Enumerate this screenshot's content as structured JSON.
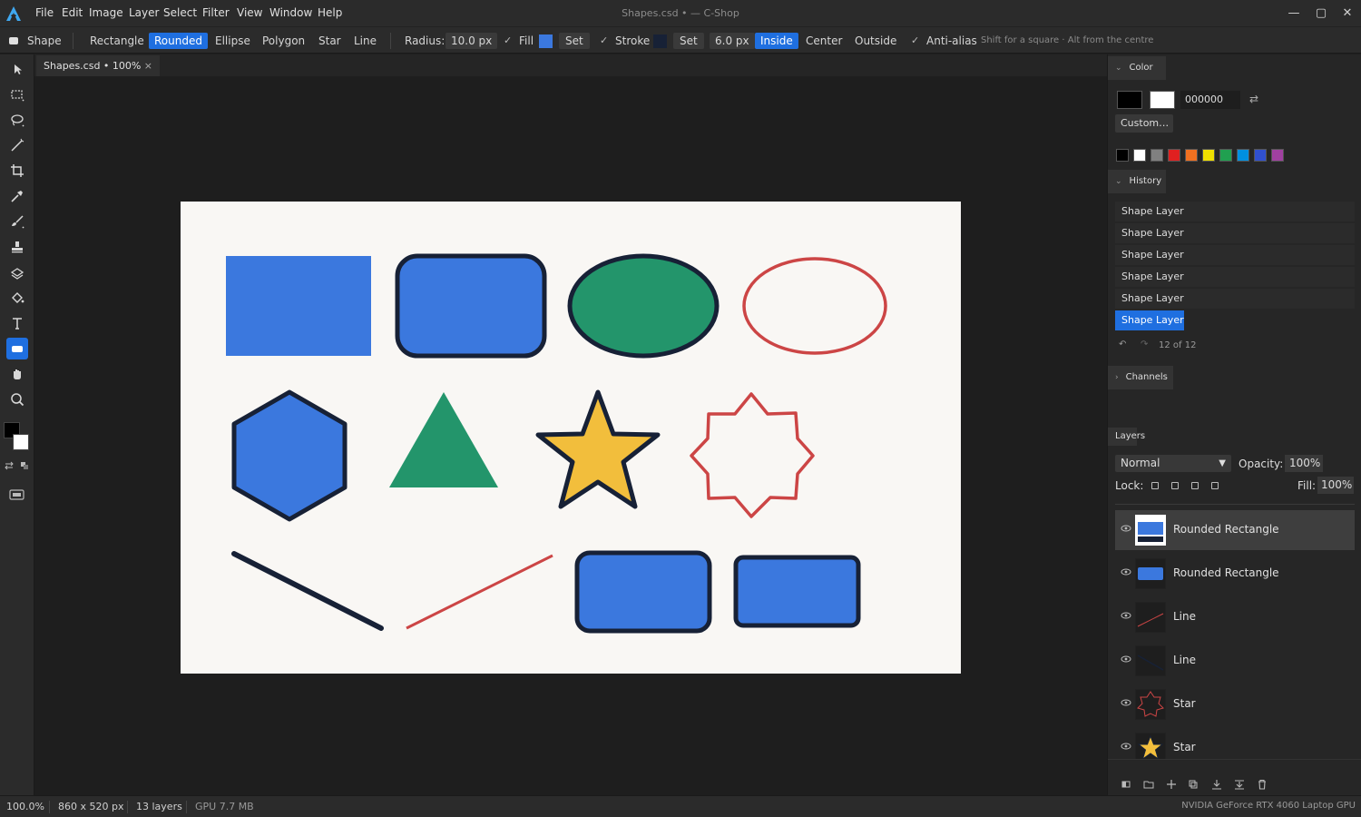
{
  "app": {
    "title": "Shapes.csd • — C-Shop",
    "logo_icon": "app-logo-icon"
  },
  "menu": [
    "File",
    "Edit",
    "Image",
    "Layer",
    "Select",
    "Filter",
    "View",
    "Window",
    "Help"
  ],
  "options": {
    "tool_label": "Shape",
    "shapes": [
      "Rectangle",
      "Rounded",
      "Ellipse",
      "Polygon",
      "Star",
      "Line"
    ],
    "active_shape": "Rounded",
    "radius_label": "Radius:",
    "radius_value": "10.0 px",
    "fill_label": "Fill",
    "fill_color": "#3b78de",
    "set_label": "Set",
    "stroke_label": "Stroke",
    "stroke_color": "#172136",
    "stroke_width": "6.0 px",
    "align": [
      "Inside",
      "Center",
      "Outside"
    ],
    "active_align": "Inside",
    "antialias_label": "Anti-alias",
    "hint": "Shift for a square · Alt from the centre"
  },
  "doc_tab": {
    "label": "Shapes.csd • 100%",
    "close": "×"
  },
  "panel": {
    "color": {
      "header": "Color",
      "hex": "000000",
      "custom_label": "Custom…",
      "palette": [
        "#000000",
        "#ffffff",
        "#808080",
        "#e02020",
        "#f07020",
        "#f0e000",
        "#20a050",
        "#0090e0",
        "#3050d0",
        "#a040a0"
      ]
    },
    "history": {
      "header": "History",
      "items": [
        "Shape Layer",
        "Shape Layer",
        "Shape Layer",
        "Shape Layer",
        "Shape Layer",
        "Shape Layer"
      ],
      "count": "12 of 12"
    },
    "channels": {
      "header": "Channels"
    },
    "layers": {
      "header": "Layers",
      "blend": "Normal",
      "opacity_label": "Opacity:",
      "opacity": "100%",
      "lock_label": "Lock:",
      "fill_label": "Fill:",
      "fill": "100%",
      "items": [
        "Rounded Rectangle",
        "Rounded Rectangle",
        "Line",
        "Line",
        "Star",
        "Star"
      ]
    }
  },
  "status": {
    "zoom": "100.0%",
    "size": "860 x 520 px",
    "layers": "13 layers",
    "gpu_mem": "GPU 7.7 MB",
    "gpu": "NVIDIA GeForce RTX 4060 Laptop GPU"
  }
}
